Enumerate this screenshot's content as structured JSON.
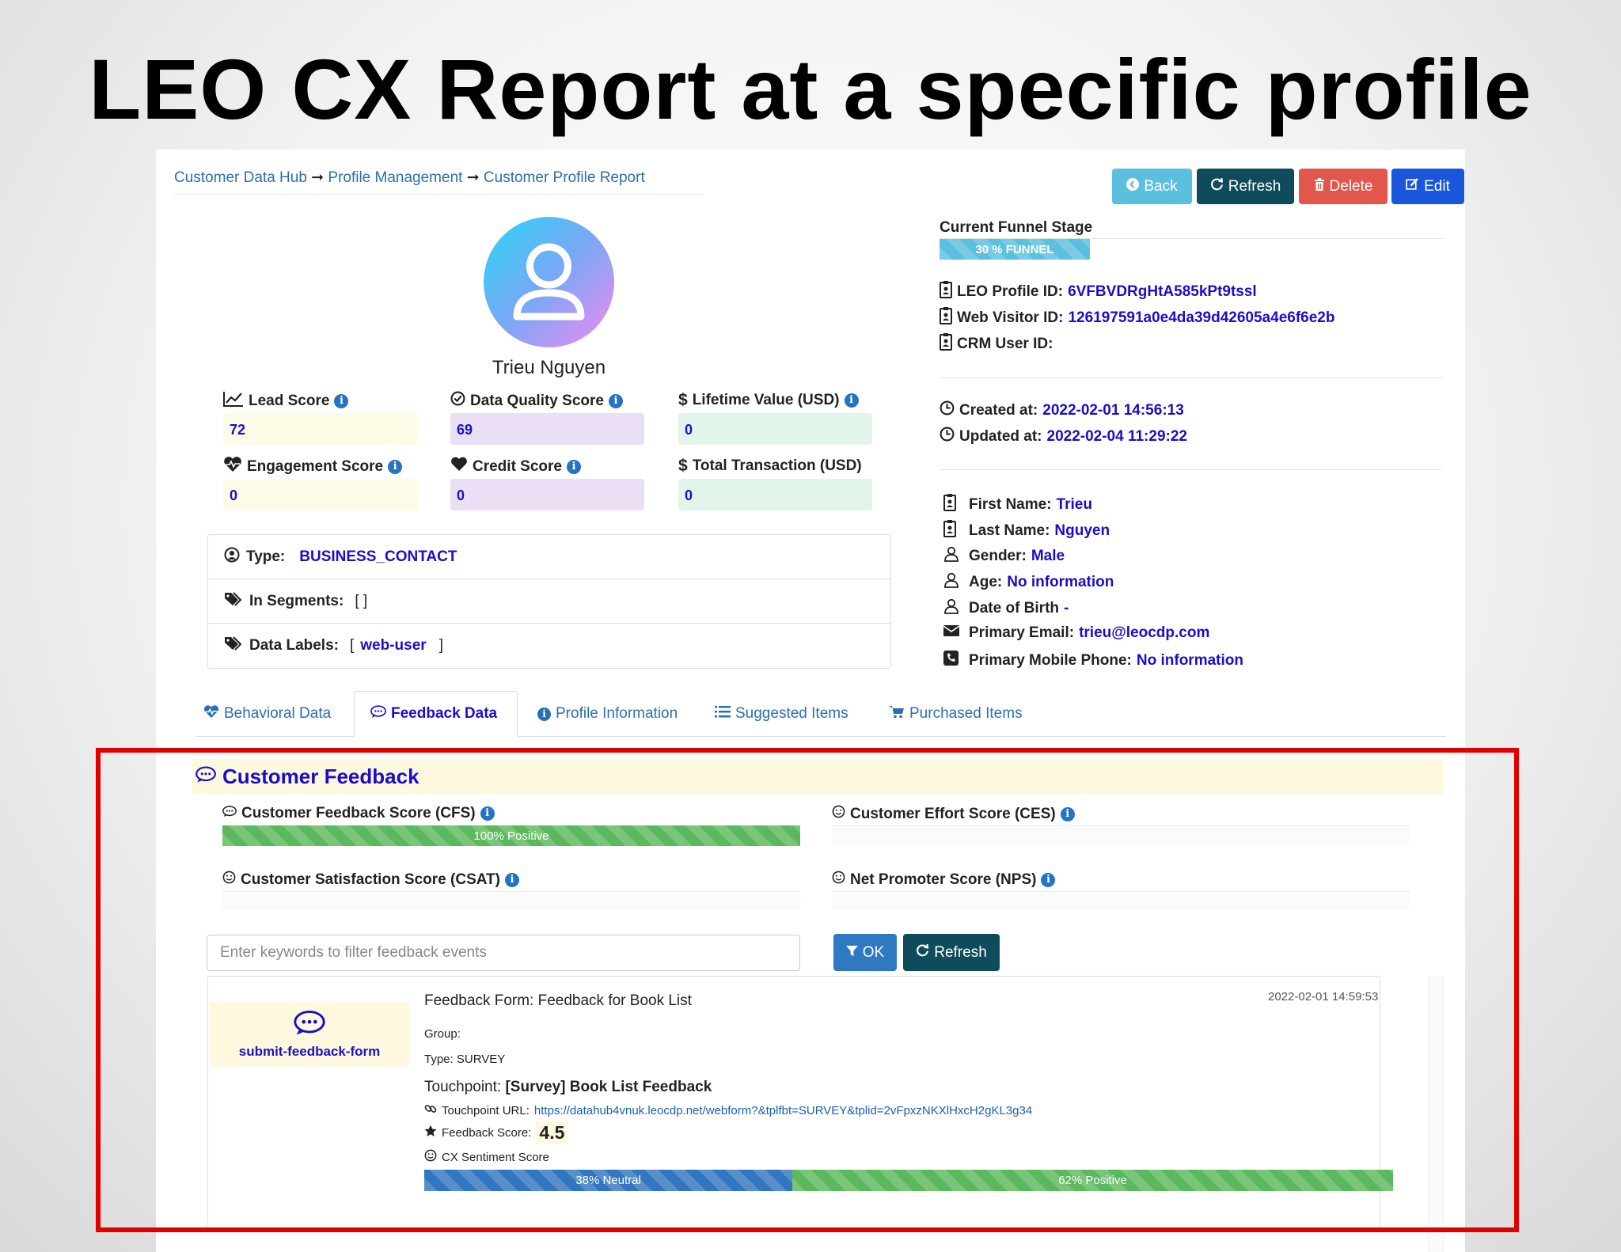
{
  "slide_title": "LEO CX Report at a specific profile",
  "breadcrumb": {
    "item1": "Customer Data Hub",
    "sep": " ➞ ",
    "item2": "Profile Management",
    "item3": "Customer Profile Report"
  },
  "buttons": {
    "back": "Back",
    "refresh": "Refresh",
    "delete": "Delete",
    "edit": "Edit"
  },
  "colors": {
    "back": "#5bc0de",
    "refresh": "#0e4c5c",
    "delete": "#e2574c",
    "edit": "#1a56db",
    "ok": "#2f78c2",
    "refresh2": "#0e4c5c"
  },
  "profile": {
    "name": "Trieu Nguyen"
  },
  "scores": {
    "lead": {
      "label": "Lead Score",
      "value": "72"
    },
    "quality": {
      "label": "Data Quality Score",
      "value": "69"
    },
    "lifetime": {
      "label": "Lifetime Value (USD)",
      "value": "0"
    },
    "engagement": {
      "label": "Engagement Score",
      "value": "0"
    },
    "credit": {
      "label": "Credit Score",
      "value": "0"
    },
    "transaction": {
      "label": "Total Transaction (USD)",
      "value": "0"
    }
  },
  "attributes": {
    "type_label": "Type:",
    "type_value": "BUSINESS_CONTACT",
    "segments_label": "In Segments:",
    "segments_value": "[ ]",
    "labels_label": "Data Labels:",
    "labels_open": "[",
    "labels_value": "web-user",
    "labels_close": "]"
  },
  "funnel": {
    "label": "Current Funnel Stage",
    "value": "30 % FUNNEL",
    "percent": 30
  },
  "ids": {
    "leo_label": "LEO Profile ID:",
    "leo_value": "6VFBVDRgHtA585kPt9tssl",
    "web_label": "Web Visitor ID:",
    "web_value": "126197591a0e4da39d42605a4e6f6e2b",
    "crm_label": "CRM User ID:"
  },
  "dates": {
    "created_label": "Created at:",
    "created_value": "2022-02-01 14:56:13",
    "updated_label": "Updated at:",
    "updated_value": "2022-02-04 11:29:22"
  },
  "info": {
    "first_label": "First Name:",
    "first_value": "Trieu",
    "last_label": "Last Name:",
    "last_value": "Nguyen",
    "gender_label": "Gender:",
    "gender_value": "Male",
    "age_label": "Age:",
    "age_value": "No information",
    "dob_label": "Date of Birth",
    "dob_value": "-",
    "email_label": "Primary Email:",
    "email_value": "trieu@leocdp.com",
    "phone_label": "Primary Mobile Phone:",
    "phone_value": "No information"
  },
  "tabs": {
    "behavioral": "Behavioral Data",
    "feedback": "Feedback Data",
    "profile": "Profile Information",
    "suggested": "Suggested Items",
    "purchased": "Purchased Items"
  },
  "feedback": {
    "header": "Customer Feedback",
    "cfs_label": "Customer Feedback Score (CFS)",
    "cfs_bar": "100% Positive",
    "cfs_percent": 100,
    "ces_label": "Customer Effort Score (CES)",
    "csat_label": "Customer Satisfaction Score (CSAT)",
    "nps_label": "Net Promoter Score (NPS)",
    "filter_placeholder": "Enter keywords to filter feedback events",
    "ok": "OK",
    "refresh": "Refresh"
  },
  "event": {
    "icon_label": "submit-feedback-form",
    "timestamp": "2022-02-01 14:59:53",
    "form_label": "Feedback Form:",
    "form_value": "Feedback for Book List",
    "group_label": "Group:",
    "type_label": "Type:",
    "type_value": "SURVEY",
    "touchpoint_label": "Touchpoint:",
    "touchpoint_value": "[Survey] Book List Feedback",
    "url_label": "Touchpoint URL:",
    "url_value": "https://datahub4vnuk.leocdp.net/webform?&tplfbt=SURVEY&tplid=2vFpxzNKXlHxcH2gKL3g34",
    "score_label": "Feedback Score:",
    "score_value": "4.5",
    "sentiment_label": "CX Sentiment Score",
    "neutral_bar": "38% Neutral",
    "neutral_percent": 38,
    "positive_bar": "62% Positive",
    "positive_percent": 62
  }
}
